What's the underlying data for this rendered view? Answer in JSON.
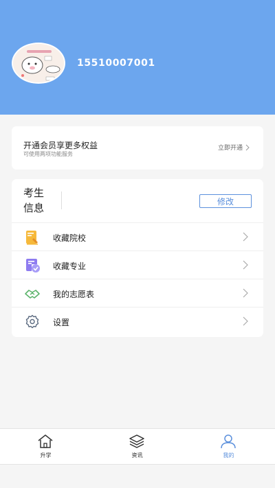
{
  "profile": {
    "phone": "15510007001"
  },
  "vip": {
    "title": "开通会员享更多权益",
    "subtitle": "可使用两项功能服务",
    "action": "立即开通"
  },
  "student_info": {
    "label_line1": "考生",
    "label_line2": "信息",
    "edit_label": "修改"
  },
  "menu": {
    "items": [
      {
        "label": "收藏院校",
        "icon": "school-bookmark-icon"
      },
      {
        "label": "收藏专业",
        "icon": "major-bookmark-icon"
      },
      {
        "label": "我的志愿表",
        "icon": "handshake-icon"
      },
      {
        "label": "设置",
        "icon": "gear-icon"
      }
    ]
  },
  "tabbar": {
    "tabs": [
      {
        "label": "升学",
        "icon": "home-icon"
      },
      {
        "label": "资讯",
        "icon": "layers-icon"
      },
      {
        "label": "我的",
        "icon": "user-icon",
        "active": true
      }
    ]
  },
  "colors": {
    "header": "#6ca6ee",
    "accent": "#5a8fdc",
    "background": "#f5f5f5"
  }
}
